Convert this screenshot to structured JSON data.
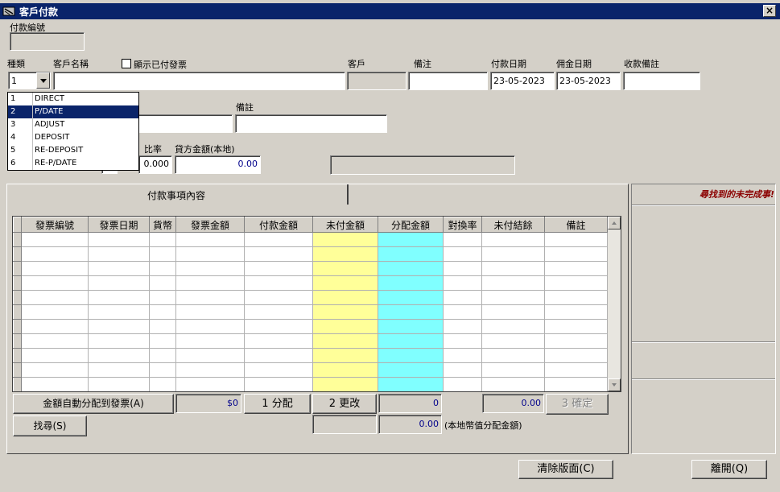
{
  "window": {
    "title": "客戶付款",
    "close": "×"
  },
  "form": {
    "payment_no_label": "付款編號",
    "type_label": "種類",
    "type_value": "1",
    "customer_name_label": "客戶名稱",
    "show_paid_label": "顯示已付發票",
    "customer_label": "客戶",
    "remark_label": "備注",
    "pay_date_label": "付款日期",
    "pay_date_value": "23-05-2023",
    "commission_date_label": "佣金日期",
    "commission_date_value": "23-05-2023",
    "receipt_remark_label": "收款備註",
    "remark2_label": "備註",
    "rate_label": "比率",
    "rate_value": "0.000",
    "credit_local_label": "貸方金額(本地)",
    "credit_local_value": "0.00"
  },
  "dropdown": {
    "items": [
      {
        "code": "1",
        "name": "DIRECT"
      },
      {
        "code": "2",
        "name": "P/DATE"
      },
      {
        "code": "3",
        "name": "ADJUST"
      },
      {
        "code": "4",
        "name": "DEPOSIT"
      },
      {
        "code": "5",
        "name": "RE-DEPOSIT"
      },
      {
        "code": "6",
        "name": "RE-P/DATE"
      }
    ],
    "selected_index": 1
  },
  "tabs": {
    "payment_items": "付款事項內容"
  },
  "grid": {
    "columns": [
      "發票編號",
      "發票日期",
      "貨幣",
      "發票金額",
      "付款金額",
      "未付金額",
      "分配金額",
      "對換率",
      "未付結餘",
      "備註"
    ],
    "row_count": 11
  },
  "side_panel": {
    "title": "尋找到的未完成事!"
  },
  "footer": {
    "auto_alloc_label": "金額自動分配到發票(A)",
    "amount_value": "$0",
    "alloc_button": "1 分配",
    "change_button": "2 更改",
    "alloc_amount_value": "0",
    "unpaid_balance_value": "0.00",
    "confirm_button": "3 確定",
    "search_button": "找尋(S)",
    "local_alloc_value": "0.00",
    "local_alloc_label": "(本地幣值分配金額)",
    "clear_button": "清除版面(C)",
    "exit_button": "離開(Q)"
  },
  "colors": {
    "titlebar": "#0a246a",
    "unpaid_col": "#ffff99",
    "alloc_col": "#80ffff"
  }
}
